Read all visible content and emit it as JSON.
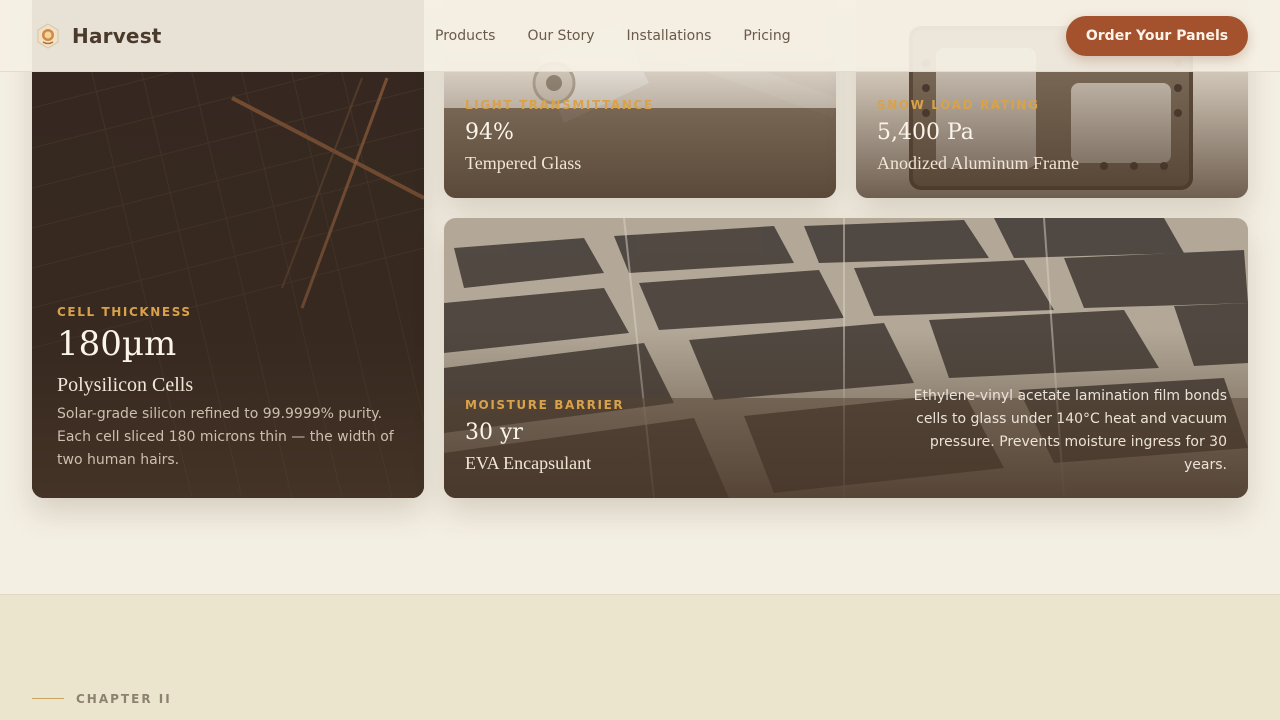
{
  "nav": {
    "brand": "Harvest",
    "links": [
      "Products",
      "Our Story",
      "Installations",
      "Pricing"
    ],
    "cta": "Order Your Panels"
  },
  "cards": {
    "cell": {
      "eyebrow": "CELL THICKNESS",
      "stat": "180µm",
      "title": "Polysilicon Cells",
      "description": "Solar-grade silicon refined to 99.9999% purity. Each cell sliced 180 microns thin — the width of two human hairs."
    },
    "glass": {
      "eyebrow": "LIGHT TRANSMITTANCE",
      "stat": "94%",
      "title": "Tempered Glass"
    },
    "frame": {
      "eyebrow": "SNOW LOAD RATING",
      "stat": "5,400 Pa",
      "title": "Anodized Aluminum Frame"
    },
    "eva": {
      "eyebrow": "MOISTURE BARRIER",
      "stat": "30 yr",
      "title": "EVA Encapsulant",
      "description": "Ethylene-vinyl acetate lamination film bonds cells to glass under 140°C heat and vacuum pressure. Prevents moisture ingress for 30 years."
    }
  },
  "chapter": {
    "label": "CHAPTER II"
  },
  "colors": {
    "accent": "#a4522e",
    "eyebrow": "#d9a24a",
    "background": "#f4efe3",
    "chapter_band": "#ebe5cd"
  }
}
